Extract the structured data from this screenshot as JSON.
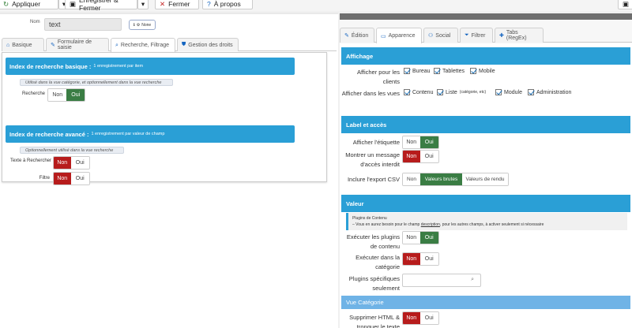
{
  "toolbar": {
    "apply_label": "Appliquer",
    "save_close_label": "Enregistrer & Fermer",
    "close_label": "Fermer",
    "about_label": "À propos"
  },
  "field": {
    "name_label": "Nom",
    "name_value": "text",
    "badge_label": "None"
  },
  "left_tabs": [
    "Basique",
    "Formulaire de saisie",
    "Recherche, Filtrage",
    "Gestion des droits"
  ],
  "basic_index": {
    "title": "Index de recherche basique :",
    "subtitle": "1 enregistrement par item",
    "note": "Utilisé dans la vue catégorie, et optionnellement dans la vue recherche",
    "search_label": "Recherche",
    "no": "Non",
    "yes": "Oui"
  },
  "advanced_index": {
    "title": "Index de recherche avancé :",
    "subtitle": "1 enregistrement par valeur de champ",
    "note": "Optionnellement utilisé dans la vue recherche",
    "text_search_label": "Texte à Rechercher",
    "filter_label": "Filtre",
    "no": "Non",
    "yes": "Oui"
  },
  "right_tabs": [
    "Édition",
    "Apparence",
    "Social",
    "Filtrer",
    "Tabs (RegEx)"
  ],
  "display": {
    "title": "Affichage",
    "clients_label": "Afficher pour les clients",
    "clients": [
      "Bureau",
      "Tablettes",
      "Mobile"
    ],
    "views_label": "Afficher dans les vues",
    "views": [
      "Contenu",
      "Liste",
      "Module",
      "Administration"
    ],
    "views_list_note": "(catégorie, etc)"
  },
  "label_access": {
    "title": "Label et accès",
    "show_label": "Afficher l'étiquette",
    "show_message_label": "Montrer un message d'accès interdit",
    "csv_label": "Inclure l'export CSV",
    "csv_options": [
      "Non",
      "Valeurs brutes",
      "Valeurs de rendu"
    ],
    "no": "Non",
    "yes": "Oui"
  },
  "value": {
    "title": "Valeur",
    "info_title": "Plugins de Contenu",
    "info_text_1": "– Vous en aurez besoin pour le champ",
    "info_link": "description",
    "info_text_2": ", pour les autres champs, à activer seulement si nécessaire",
    "run_plugins_label": "Exécuter les plugins de contenu",
    "run_category_label": "Exécuter dans la catégorie",
    "specific_plugins_label": "Plugins spécifiques seulement",
    "no": "Non",
    "yes": "Oui"
  },
  "category_view": {
    "title": "Vue Catégorie",
    "strip_label": "Supprimer HTML & tronquer le texte",
    "no": "Non",
    "yes": "Oui"
  }
}
